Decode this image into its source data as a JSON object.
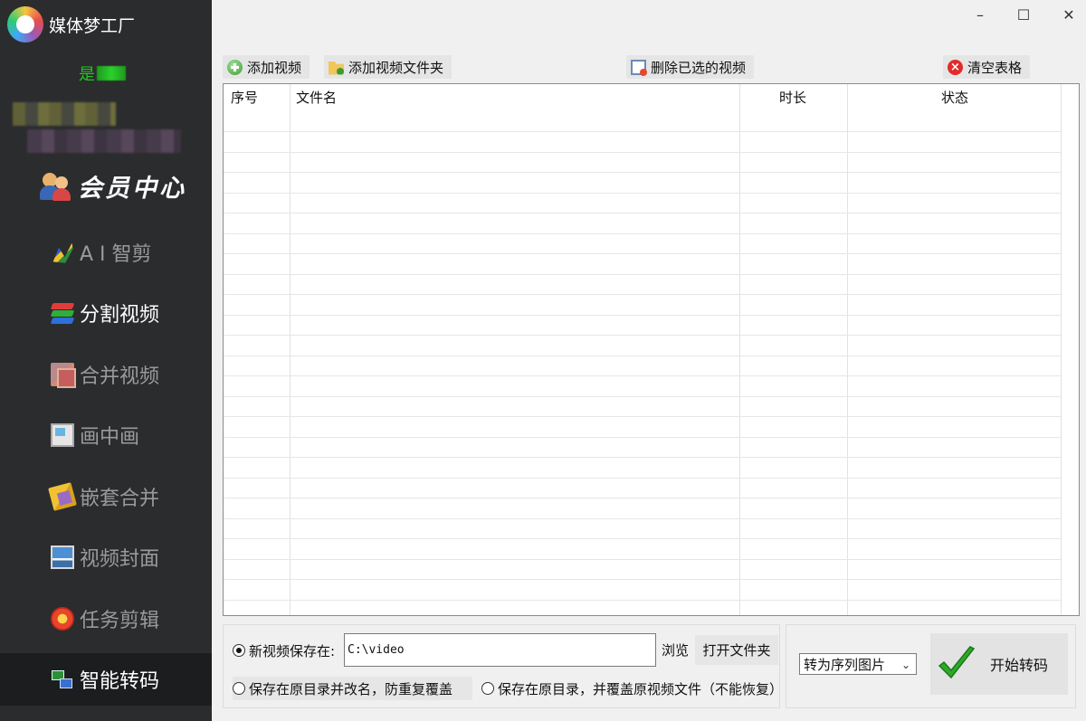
{
  "app": {
    "title": "媒体梦工厂",
    "user_status_prefix": "是",
    "member_center": "会员中心"
  },
  "nav": [
    {
      "label": "A I 智剪",
      "icon": "ai-cut-icon"
    },
    {
      "label": "分割视频",
      "icon": "split-video-icon"
    },
    {
      "label": "合并视频",
      "icon": "merge-video-icon"
    },
    {
      "label": "画中画",
      "icon": "picture-in-picture-icon"
    },
    {
      "label": "嵌套合并",
      "icon": "nested-merge-icon"
    },
    {
      "label": "视频封面",
      "icon": "video-cover-icon"
    },
    {
      "label": "任务剪辑",
      "icon": "task-edit-icon"
    },
    {
      "label": "智能转码",
      "icon": "smart-transcode-icon",
      "active": true
    }
  ],
  "window": {
    "minimize": "–",
    "maximize": "☐",
    "close": "✕"
  },
  "toolbar": {
    "add_video": "添加视频",
    "add_folder": "添加视频文件夹",
    "delete_selected": "删除已选的视频",
    "clear_table": "清空表格"
  },
  "table": {
    "columns": [
      "序号",
      "文件名",
      "时长",
      "状态"
    ],
    "rows": []
  },
  "output": {
    "save_new_label": "新视频保存在:",
    "save_path": "C:\\video",
    "browse": "浏览",
    "open_folder": "打开文件夹",
    "save_rename_label": "保存在原目录并改名，防重复覆盖",
    "save_overwrite_label": "保存在原目录，并覆盖原视频文件（不能恢复）"
  },
  "convert": {
    "mode_selected": "转为序列图片",
    "start_label": "开始转码"
  },
  "colors": {
    "sidebar_bg": "#2b2c2e",
    "sidebar_active_bg": "#1c1d1f",
    "user_status_green": "#22c322",
    "check_green": "#2fa82a"
  }
}
